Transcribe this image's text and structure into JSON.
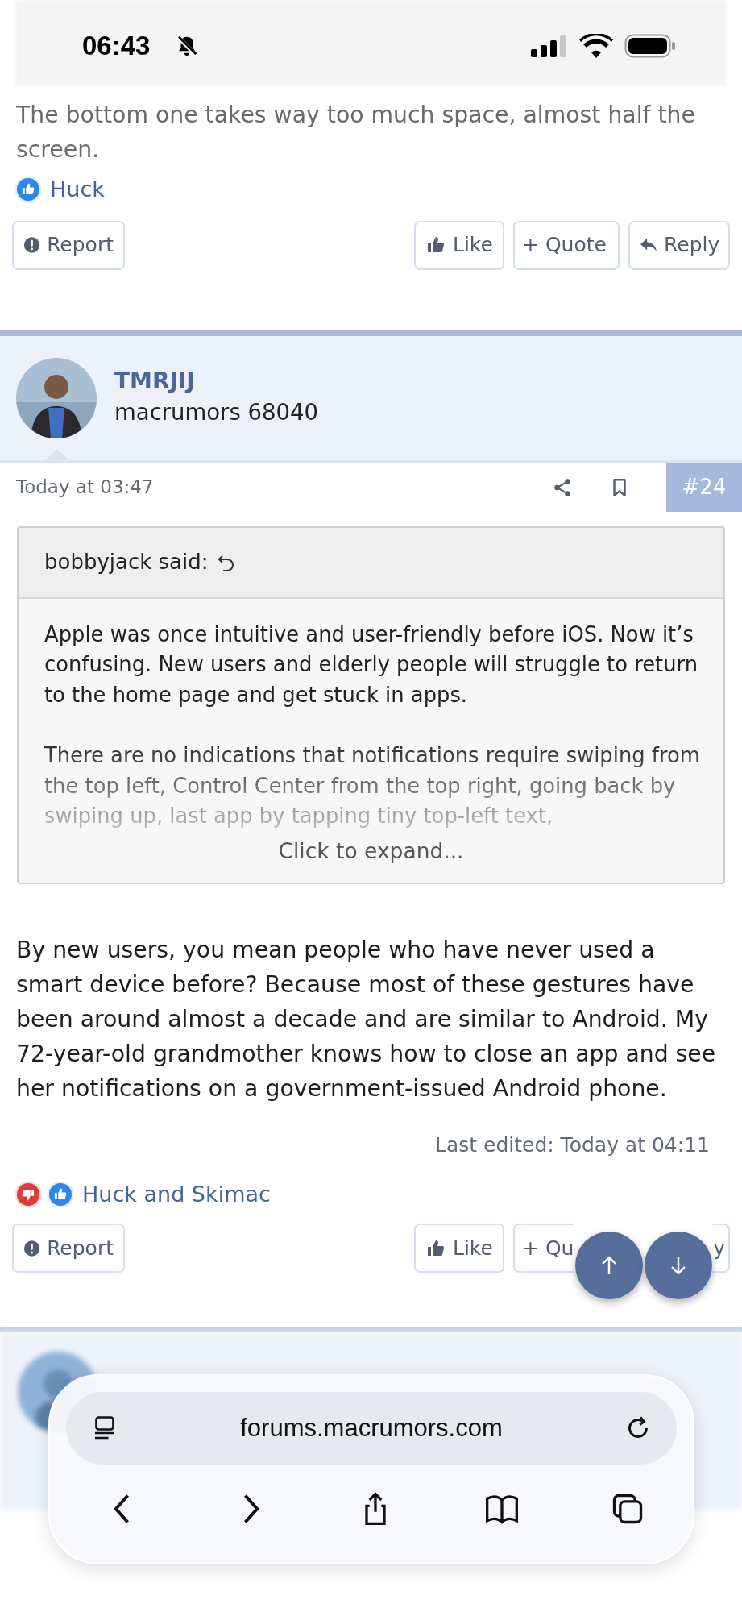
{
  "status_bar": {
    "time": "06:43",
    "silent": true
  },
  "previous_post": {
    "text": "The bottom one takes way too much space, almost half the screen.",
    "reactions": [
      {
        "kind": "like"
      }
    ],
    "reaction_users": "Huck",
    "actions": [
      {
        "kind": "report",
        "label": "Report"
      },
      {
        "kind": "like",
        "label": "Like"
      },
      {
        "kind": "quote",
        "label": "+ Quote"
      },
      {
        "kind": "reply",
        "label": "Reply"
      }
    ]
  },
  "post": {
    "author": {
      "name": "TMRJIJ",
      "title": "macrumors 68040"
    },
    "date": "Today at 03:47",
    "number": "#24",
    "quote": {
      "author": "bobbyjack said:",
      "paragraphs": [
        "Apple was once intuitive and user-friendly before iOS. Now it’s confusing. New users and elderly people will struggle to return to the home page and get stuck in apps.",
        "There are no indications that notifications require swiping from the top left, Control Center from the top right, going back by swiping up, last app by tapping tiny top-left text,"
      ],
      "expand": "Click to expand..."
    },
    "body": "By new users, you mean people who have never used a smart device before? Because most of these gestures have been around almost a decade and are similar to Android. My 72-year-old grandmother knows how to close an app and see her notifications on a government-issued Android phone.",
    "last_edited": "Last edited: Today at 04:11",
    "reactions": [
      {
        "kind": "dislike"
      },
      {
        "kind": "like"
      }
    ],
    "reaction_users": "Huck and Skimac",
    "actions": [
      {
        "kind": "report",
        "label": "Report"
      },
      {
        "kind": "like",
        "label": "Like"
      },
      {
        "kind": "quote",
        "label": "+ Qu"
      },
      {
        "kind": "reply",
        "label": "y"
      }
    ]
  },
  "browser": {
    "url": "forums.macrumors.com"
  }
}
